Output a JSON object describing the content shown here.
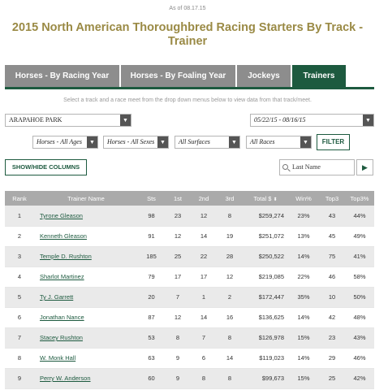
{
  "as_of": "As of 08.17.15",
  "title": "2015 North American Thoroughbred Racing Starters By Track - Trainer",
  "tabs": [
    {
      "label": "Horses - By Racing Year",
      "active": false
    },
    {
      "label": "Horses - By Foaling Year",
      "active": false
    },
    {
      "label": "Jockeys",
      "active": false
    },
    {
      "label": "Trainers",
      "active": true
    }
  ],
  "instructions": "Select a track and a race meet from the drop down menus below to view data from that track/meet.",
  "filters": {
    "track": "ARAPAHOE PARK",
    "meet": "05/22/15 - 08/16/15",
    "ages": "Horses - All Ages",
    "sexes": "Horses - All Sexes",
    "surfaces": "All Surfaces",
    "races": "All Races",
    "filter_label": "FILTER"
  },
  "show_hide_label": "SHOW/HIDE COLUMNS",
  "search": {
    "placeholder": "Last Name",
    "go": "▶"
  },
  "table": {
    "headers": [
      "Rank",
      "Trainer Name",
      "Sts",
      "1st",
      "2nd",
      "3rd",
      "Total $",
      "Win%",
      "Top3",
      "Top3%"
    ],
    "rows": [
      {
        "rank": "1",
        "name": "Tyrone Gleason",
        "sts": "98",
        "first": "23",
        "second": "12",
        "third": "8",
        "total": "$259,274",
        "win": "23%",
        "top3": "43",
        "top3pct": "44%"
      },
      {
        "rank": "2",
        "name": "Kenneth Gleason",
        "sts": "91",
        "first": "12",
        "second": "14",
        "third": "19",
        "total": "$251,072",
        "win": "13%",
        "top3": "45",
        "top3pct": "49%"
      },
      {
        "rank": "3",
        "name": "Temple D. Rushton",
        "sts": "185",
        "first": "25",
        "second": "22",
        "third": "28",
        "total": "$250,522",
        "win": "14%",
        "top3": "75",
        "top3pct": "41%"
      },
      {
        "rank": "4",
        "name": "Sharlot Martinez",
        "sts": "79",
        "first": "17",
        "second": "17",
        "third": "12",
        "total": "$219,085",
        "win": "22%",
        "top3": "46",
        "top3pct": "58%"
      },
      {
        "rank": "5",
        "name": "Ty J. Garrett",
        "sts": "20",
        "first": "7",
        "second": "1",
        "third": "2",
        "total": "$172,447",
        "win": "35%",
        "top3": "10",
        "top3pct": "50%"
      },
      {
        "rank": "6",
        "name": "Jonathan Nance",
        "sts": "87",
        "first": "12",
        "second": "14",
        "third": "16",
        "total": "$136,625",
        "win": "14%",
        "top3": "42",
        "top3pct": "48%"
      },
      {
        "rank": "7",
        "name": "Stacey Rushton",
        "sts": "53",
        "first": "8",
        "second": "7",
        "third": "8",
        "total": "$126,978",
        "win": "15%",
        "top3": "23",
        "top3pct": "43%"
      },
      {
        "rank": "8",
        "name": "W. Monk Hall",
        "sts": "63",
        "first": "9",
        "second": "6",
        "third": "14",
        "total": "$119,023",
        "win": "14%",
        "top3": "29",
        "top3pct": "46%"
      },
      {
        "rank": "9",
        "name": "Perry W. Anderson",
        "sts": "60",
        "first": "9",
        "second": "8",
        "third": "8",
        "total": "$99,673",
        "win": "15%",
        "top3": "25",
        "top3pct": "42%"
      }
    ]
  }
}
